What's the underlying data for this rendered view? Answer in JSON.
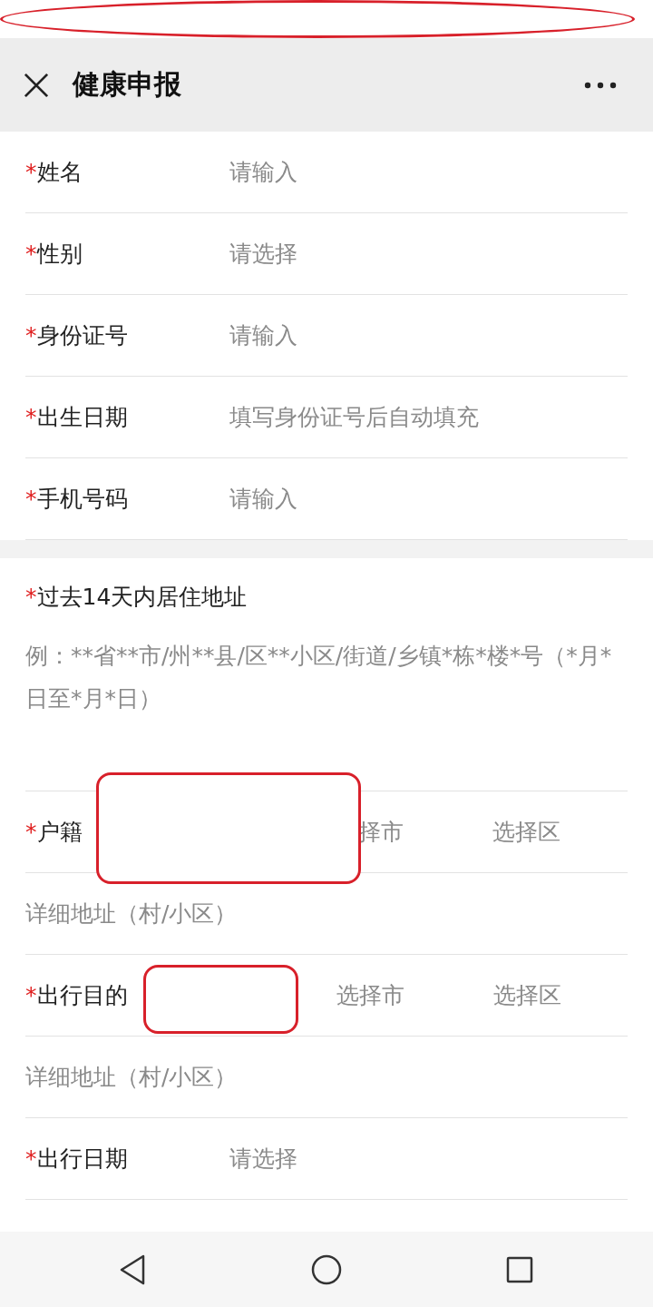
{
  "header": {
    "title": "健康申报"
  },
  "section_1": [
    {
      "kind": "field",
      "required_mark": "*",
      "label": "姓名",
      "placeholder": "请输入"
    },
    {
      "kind": "field",
      "required_mark": "*",
      "label": "性别",
      "placeholder": "请选择"
    },
    {
      "kind": "field",
      "required_mark": "*",
      "label": "身份证号",
      "placeholder": "请输入"
    },
    {
      "kind": "field",
      "required_mark": "*",
      "label": "出生日期",
      "placeholder": "填写身份证号后自动填充"
    },
    {
      "kind": "field",
      "required_mark": "*",
      "label": "手机号码",
      "placeholder": "请输入"
    }
  ],
  "residence": {
    "required_mark": "*",
    "title": "过去14天内居住地址",
    "hint": "例：**省**市/州**县/区**小区/街道/乡镇*栋*楼*号（*月*日至*月*日）"
  },
  "section_2": [
    {
      "kind": "address",
      "required_mark": "*",
      "label": "户籍",
      "city": "择市",
      "district": "选择区"
    },
    {
      "kind": "detail",
      "placeholder": "详细地址（村/小区）"
    },
    {
      "kind": "address",
      "required_mark": "*",
      "label": "出行目的",
      "city": "选择市",
      "district": "选择区"
    },
    {
      "kind": "detail",
      "placeholder": "详细地址（村/小区）"
    },
    {
      "kind": "field",
      "required_mark": "*",
      "label": "出行日期",
      "placeholder": "请选择"
    }
  ],
  "redaction_marks": [
    {
      "kind": "oval"
    },
    {
      "kind": "rect"
    },
    {
      "kind": "rect"
    }
  ]
}
